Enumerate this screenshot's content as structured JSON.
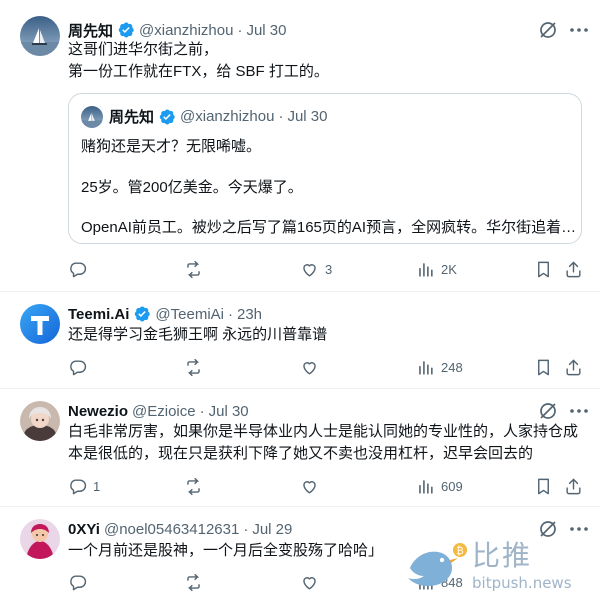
{
  "colors": {
    "text": "#0f1419",
    "muted": "#536471",
    "verified": "#1d9bf0",
    "border": "#cfd9de"
  },
  "tweets": [
    {
      "name": "周先知",
      "handle": "@xianzhizhou",
      "dot": "·",
      "date": "Jul 30",
      "lines": [
        "这哥们进华尔街之前，",
        "第一份工作就在FTX，给 SBF 打工的。"
      ],
      "quote": {
        "name": "周先知",
        "handle": "@xianzhizhou",
        "dot": "·",
        "date": "Jul 30",
        "lines": [
          "赌狗还是天才？无限唏嘘。",
          "25岁。管200亿美金。今天爆了。",
          "OpenAI前员工。被炒之后写了篇165页的AI预言，全网疯转。华尔街追着…"
        ]
      },
      "stats": {
        "reply": "",
        "repost": "",
        "like": "3",
        "views": "2K"
      }
    },
    {
      "name": "Teemi.Ai",
      "handle": "@TeemiAi",
      "dot": "·",
      "date": "23h",
      "lines": [
        "还是得学习金毛狮王啊 永远的川普靠谱"
      ],
      "stats": {
        "reply": "",
        "repost": "",
        "like": "",
        "views": "248"
      }
    },
    {
      "name": "Newezio",
      "handle": "@Ezioice",
      "dot": "·",
      "date": "Jul 30",
      "lines": [
        "白毛非常厉害，如果你是半导体业内人士是能认同她的专业性的，人家持仓成",
        "本是很低的，现在只是获利下降了她又不卖也没用杠杆，迟早会回去的"
      ],
      "stats": {
        "reply": "1",
        "repost": "",
        "like": "",
        "views": "609"
      }
    },
    {
      "name": "0XYi",
      "handle": "@noel05463412631",
      "dot": "·",
      "date": "Jul 29",
      "lines": [
        "一个月前还是股神，一个月后全变股殇了哈哈」"
      ],
      "stats": {
        "reply": "",
        "repost": "",
        "like": "",
        "views": "848"
      }
    }
  ],
  "watermark": {
    "cn": "比推",
    "en": "bitpush.news"
  }
}
